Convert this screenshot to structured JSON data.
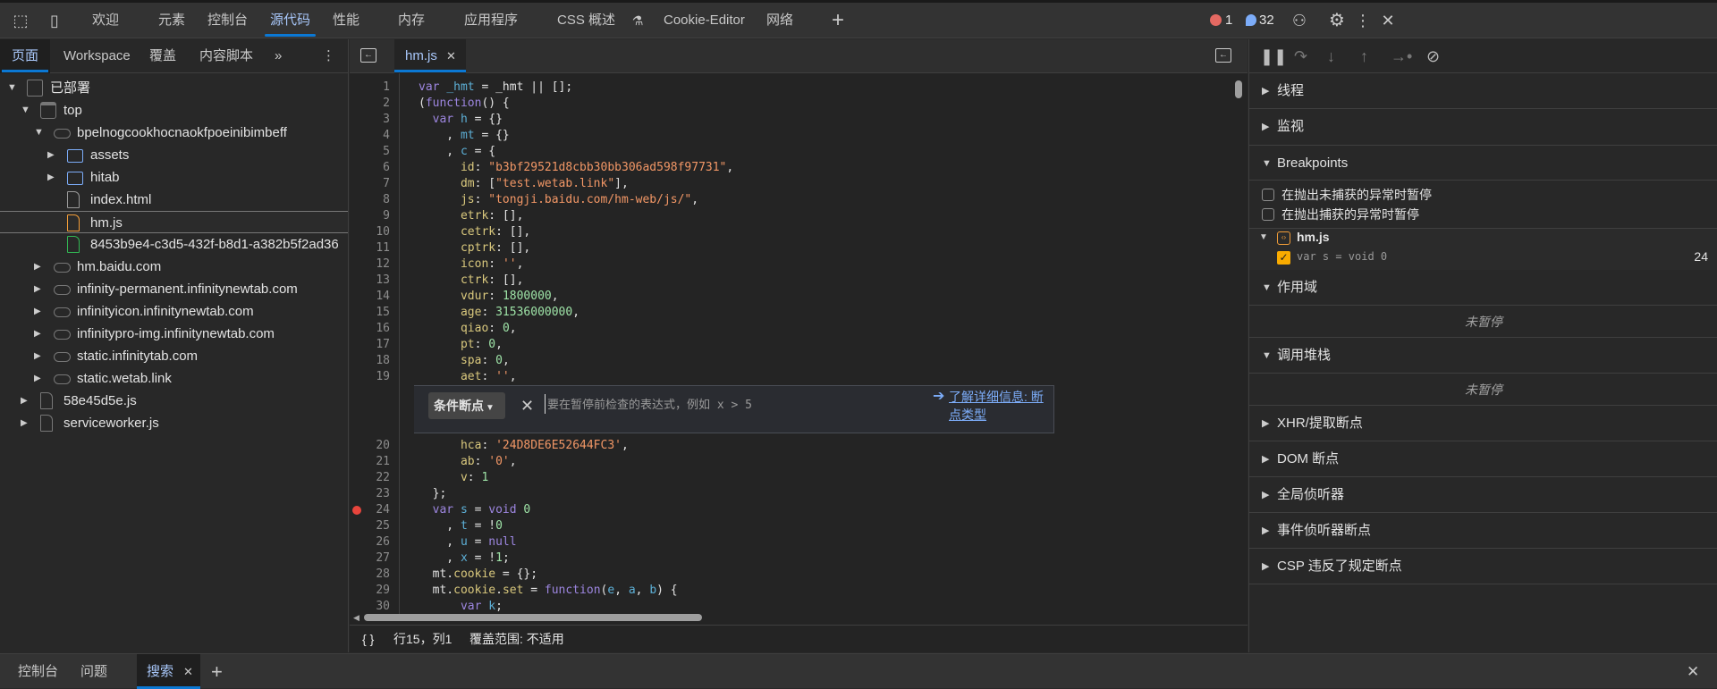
{
  "topbar": {
    "tabs": [
      "欢迎",
      "元素",
      "控制台",
      "源代码",
      "性能",
      "内存",
      "应用程序",
      "CSS 概述",
      "Cookie-Editor",
      "网络"
    ],
    "active_tab": "源代码",
    "error_count": "1",
    "message_count": "32"
  },
  "navigator": {
    "tabs": [
      "页面",
      "Workspace",
      "覆盖",
      "内容脚本"
    ],
    "active_tab": "页面",
    "tree": [
      {
        "label": "已部署",
        "indent": 0,
        "arrow": "down",
        "icon": "cube"
      },
      {
        "label": "top",
        "indent": 1,
        "arrow": "down",
        "icon": "frame"
      },
      {
        "label": "bpelnogcookhocnaokfpoeinibimbeff",
        "indent": 2,
        "arrow": "down",
        "icon": "cloud"
      },
      {
        "label": "assets",
        "indent": 3,
        "arrow": "right",
        "icon": "folder"
      },
      {
        "label": "hitab",
        "indent": 3,
        "arrow": "right",
        "icon": "folder"
      },
      {
        "label": "index.html",
        "indent": 3,
        "arrow": "",
        "icon": "file"
      },
      {
        "label": "hm.js",
        "indent": 3,
        "arrow": "",
        "icon": "file-js",
        "selected": true
      },
      {
        "label": "8453b9e4-c3d5-432f-b8d1-a382b5f2ad36",
        "indent": 3,
        "arrow": "",
        "icon": "file-green"
      },
      {
        "label": "hm.baidu.com",
        "indent": 2,
        "arrow": "right",
        "icon": "cloud"
      },
      {
        "label": "infinity-permanent.infinitynewtab.com",
        "indent": 2,
        "arrow": "right",
        "icon": "cloud"
      },
      {
        "label": "infinityicon.infinitynewtab.com",
        "indent": 2,
        "arrow": "right",
        "icon": "cloud"
      },
      {
        "label": "infinitypro-img.infinitynewtab.com",
        "indent": 2,
        "arrow": "right",
        "icon": "cloud"
      },
      {
        "label": "static.infinitytab.com",
        "indent": 2,
        "arrow": "right",
        "icon": "cloud"
      },
      {
        "label": "static.wetab.link",
        "indent": 2,
        "arrow": "right",
        "icon": "cloud"
      },
      {
        "label": "58e45d5e.js",
        "indent": 1,
        "arrow": "right",
        "icon": "file-gear"
      },
      {
        "label": "serviceworker.js",
        "indent": 1,
        "arrow": "right",
        "icon": "file-gear"
      }
    ]
  },
  "editor": {
    "tab": "hm.js",
    "breakpoint_line": 24,
    "lines": [
      [
        [
          "k",
          "var "
        ],
        [
          "v",
          "_hmt"
        ],
        [
          "o",
          " = _hmt || [];"
        ]
      ],
      [
        [
          "o",
          "("
        ],
        [
          "k",
          "function"
        ],
        [
          "o",
          "() {"
        ]
      ],
      [
        [
          "o",
          "  "
        ],
        [
          "k",
          "var "
        ],
        [
          "v",
          "h"
        ],
        [
          "o",
          " = {}"
        ]
      ],
      [
        [
          "o",
          "    , "
        ],
        [
          "v",
          "mt"
        ],
        [
          "o",
          " = {}"
        ]
      ],
      [
        [
          "o",
          "    , "
        ],
        [
          "v",
          "c"
        ],
        [
          "o",
          " = {"
        ]
      ],
      [
        [
          "o",
          "      "
        ],
        [
          "p",
          "id"
        ],
        [
          "o",
          ": "
        ],
        [
          "s",
          "\"b3bf29521d8cbb30bb306ad598f97731\""
        ],
        [
          "o",
          ","
        ]
      ],
      [
        [
          "o",
          "      "
        ],
        [
          "p",
          "dm"
        ],
        [
          "o",
          ": ["
        ],
        [
          "s",
          "\"test.wetab.link\""
        ],
        [
          "o",
          "],"
        ]
      ],
      [
        [
          "o",
          "      "
        ],
        [
          "p",
          "js"
        ],
        [
          "o",
          ": "
        ],
        [
          "s",
          "\"tongji.baidu.com/hm-web/js/\""
        ],
        [
          "o",
          ","
        ]
      ],
      [
        [
          "o",
          "      "
        ],
        [
          "p",
          "etrk"
        ],
        [
          "o",
          ": [],"
        ]
      ],
      [
        [
          "o",
          "      "
        ],
        [
          "p",
          "cetrk"
        ],
        [
          "o",
          ": [],"
        ]
      ],
      [
        [
          "o",
          "      "
        ],
        [
          "p",
          "cptrk"
        ],
        [
          "o",
          ": [],"
        ]
      ],
      [
        [
          "o",
          "      "
        ],
        [
          "p",
          "icon"
        ],
        [
          "o",
          ": "
        ],
        [
          "s",
          "''"
        ],
        [
          "o",
          ","
        ]
      ],
      [
        [
          "o",
          "      "
        ],
        [
          "p",
          "ctrk"
        ],
        [
          "o",
          ": [],"
        ]
      ],
      [
        [
          "o",
          "      "
        ],
        [
          "p",
          "vdur"
        ],
        [
          "o",
          ": "
        ],
        [
          "n",
          "1800000"
        ],
        [
          "o",
          ","
        ]
      ],
      [
        [
          "o",
          "      "
        ],
        [
          "p",
          "age"
        ],
        [
          "o",
          ": "
        ],
        [
          "n",
          "31536000000"
        ],
        [
          "o",
          ","
        ]
      ],
      [
        [
          "o",
          "      "
        ],
        [
          "p",
          "qiao"
        ],
        [
          "o",
          ": "
        ],
        [
          "n",
          "0"
        ],
        [
          "o",
          ","
        ]
      ],
      [
        [
          "o",
          "      "
        ],
        [
          "p",
          "pt"
        ],
        [
          "o",
          ": "
        ],
        [
          "n",
          "0"
        ],
        [
          "o",
          ","
        ]
      ],
      [
        [
          "o",
          "      "
        ],
        [
          "p",
          "spa"
        ],
        [
          "o",
          ": "
        ],
        [
          "n",
          "0"
        ],
        [
          "o",
          ","
        ]
      ],
      [
        [
          "o",
          "      "
        ],
        [
          "p",
          "aet"
        ],
        [
          "o",
          ": "
        ],
        [
          "s",
          "''"
        ],
        [
          "o",
          ","
        ]
      ],
      [
        [
          "o",
          "      "
        ],
        [
          "p",
          "hca"
        ],
        [
          "o",
          ": "
        ],
        [
          "s",
          "'24D8DE6E52644FC3'"
        ],
        [
          "o",
          ","
        ]
      ],
      [
        [
          "o",
          "      "
        ],
        [
          "p",
          "ab"
        ],
        [
          "o",
          ": "
        ],
        [
          "s",
          "'0'"
        ],
        [
          "o",
          ","
        ]
      ],
      [
        [
          "o",
          "      "
        ],
        [
          "p",
          "v"
        ],
        [
          "o",
          ": "
        ],
        [
          "n",
          "1"
        ]
      ],
      [
        [
          "o",
          "  };"
        ]
      ],
      [
        [
          "o",
          "  "
        ],
        [
          "k",
          "var "
        ],
        [
          "v",
          "s"
        ],
        [
          "o",
          " = "
        ],
        [
          "k",
          "void "
        ],
        [
          "n",
          "0"
        ]
      ],
      [
        [
          "o",
          "    , "
        ],
        [
          "v",
          "t"
        ],
        [
          "o",
          " = !"
        ],
        [
          "n",
          "0"
        ]
      ],
      [
        [
          "o",
          "    , "
        ],
        [
          "v",
          "u"
        ],
        [
          "o",
          " = "
        ],
        [
          "k",
          "null"
        ]
      ],
      [
        [
          "o",
          "    , "
        ],
        [
          "v",
          "x"
        ],
        [
          "o",
          " = !"
        ],
        [
          "n",
          "1"
        ],
        [
          "o",
          ";"
        ]
      ],
      [
        [
          "o",
          "  mt."
        ],
        [
          "p",
          "cookie"
        ],
        [
          "o",
          " = {};"
        ]
      ],
      [
        [
          "o",
          "  mt."
        ],
        [
          "p",
          "cookie"
        ],
        [
          "o",
          "."
        ],
        [
          "p",
          "set"
        ],
        [
          "o",
          " = "
        ],
        [
          "k",
          "function"
        ],
        [
          "o",
          "("
        ],
        [
          "v",
          "e"
        ],
        [
          "o",
          ", "
        ],
        [
          "v",
          "a"
        ],
        [
          "o",
          ", "
        ],
        [
          "v",
          "b"
        ],
        [
          "o",
          ") {"
        ]
      ],
      [
        [
          "o",
          "      "
        ],
        [
          "k",
          "var "
        ],
        [
          "v",
          "k"
        ],
        [
          "o",
          ";"
        ]
      ]
    ],
    "bp_editor": {
      "type_label": "条件断点",
      "placeholder": "要在暂停前检查的表达式，例如  x > 5",
      "learn_more": "了解详细信息: 断点类型"
    },
    "status": {
      "position": "行15，列1",
      "coverage": "覆盖范围: 不适用"
    }
  },
  "debugger": {
    "threads": "线程",
    "watch": "监视",
    "breakpoints": "Breakpoints",
    "pause_uncaught": "在抛出未捕获的异常时暂停",
    "pause_caught": "在抛出捕获的异常时暂停",
    "bp_file": "hm.js",
    "bp_code": "var s = void 0",
    "bp_line": "24",
    "bp_checked": true,
    "scope": "作用域",
    "not_paused": "未暂停",
    "call_stack": "调用堆栈",
    "sections": [
      "XHR/提取断点",
      "DOM 断点",
      "全局侦听器",
      "事件侦听器断点",
      "CSP 违反了规定断点"
    ]
  },
  "drawer": {
    "tabs": [
      "控制台",
      "问题",
      "搜索"
    ],
    "active_tab": "搜索"
  },
  "colors": {
    "accent": "#0b78d4",
    "breakpoint": "#e8453c",
    "js_file": "#f29d38"
  }
}
